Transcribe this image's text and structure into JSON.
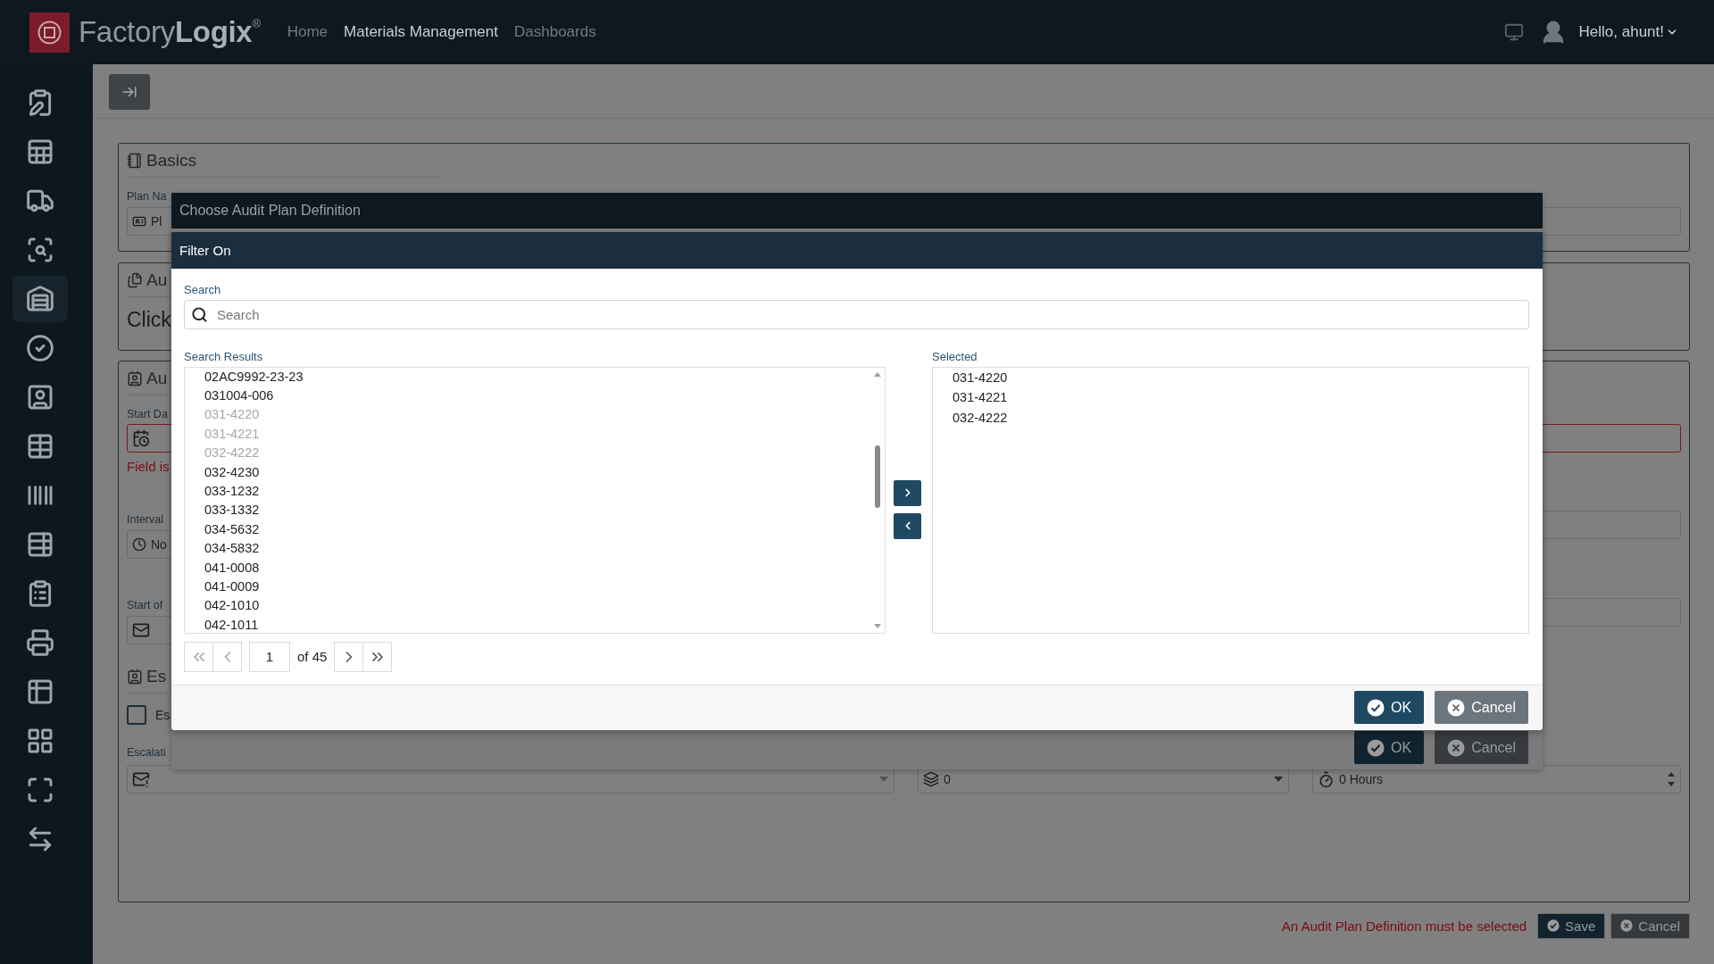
{
  "top_bar": {
    "brand": "Factory**Logix**$^{®}$",
    "nav": [
      {
        "label": "Home",
        "selected": false
      },
      {
        "label": "Materials Management",
        "selected": true
      },
      {
        "label": "Dashboards",
        "selected": false
      }
    ],
    "user": "Hello, ahunt!"
  },
  "sidebar": {
    "items": [
      {
        "selected": false
      },
      {
        "selected": false
      },
      {
        "selected": false
      },
      {
        "selected": false
      },
      {
        "selected": true
      },
      {
        "selected": false
      },
      {
        "selected": false
      },
      {
        "selected": false
      },
      {
        "selected": false
      },
      {
        "selected": false
      },
      {
        "selected": false
      },
      {
        "selected": false
      },
      {
        "selected": false
      },
      {
        "selected": false
      },
      {
        "selected": false
      },
      {
        "selected": false
      }
    ]
  },
  "form": {
    "basics": {
      "title": "Basics",
      "plan_name_label": "Plan Na",
      "plan_name_value": "Pl"
    },
    "definition": {
      "title": "Au",
      "prompt": "Click"
    },
    "schedule": {
      "title": "Au",
      "start_date_label": "Start Da",
      "start_date_error": "Field is",
      "interval_label": "Interval",
      "interval_value": "No",
      "start_of_label": "Start of"
    },
    "escalation": {
      "title": "Es",
      "checkbox_label": "Es",
      "checked": false,
      "escalation_label": "Escalati",
      "count_value": "0",
      "duration_value": "0 Hours"
    }
  },
  "audit_dialog": {
    "title": "Choose Audit Plan Definition",
    "buttons": [
      {
        "label": "OK",
        "kind": "primary"
      },
      {
        "label": "Cancel",
        "kind": "secondary"
      }
    ]
  },
  "filter_dialog": {
    "title": "Filter On",
    "search_label": "Search",
    "search": {
      "placeholder": "Search"
    },
    "results_label": "Search Results",
    "results": [
      {
        "label": "02AC9992-23-23",
        "disabled": false
      },
      {
        "label": "031004-006",
        "disabled": false
      },
      {
        "label": "031-4220",
        "disabled": true
      },
      {
        "label": "031-4221",
        "disabled": true
      },
      {
        "label": "032-4222",
        "disabled": true
      },
      {
        "label": "032-4230",
        "disabled": false
      },
      {
        "label": "033-1232",
        "disabled": false
      },
      {
        "label": "033-1332",
        "disabled": false
      },
      {
        "label": "034-5632",
        "disabled": false
      },
      {
        "label": "034-5832",
        "disabled": false
      },
      {
        "label": "041-0008",
        "disabled": false
      },
      {
        "label": "041-0009",
        "disabled": false
      },
      {
        "label": "042-1010",
        "disabled": false
      },
      {
        "label": "042-1011",
        "disabled": false
      }
    ],
    "selected_label": "Selected",
    "selected_items": [
      "031-4220",
      "031-4221",
      "032-4222"
    ],
    "pager": {
      "page": "1",
      "total": "of 45"
    },
    "buttons": [
      {
        "label": "OK",
        "kind": "primary"
      },
      {
        "label": "Cancel",
        "kind": "secondary"
      }
    ]
  },
  "footer": {
    "error": "An Audit Plan Definition must be selected",
    "buttons": [
      {
        "label": "Save",
        "kind": "primary"
      },
      {
        "label": "Cancel",
        "kind": "secondary"
      }
    ]
  }
}
